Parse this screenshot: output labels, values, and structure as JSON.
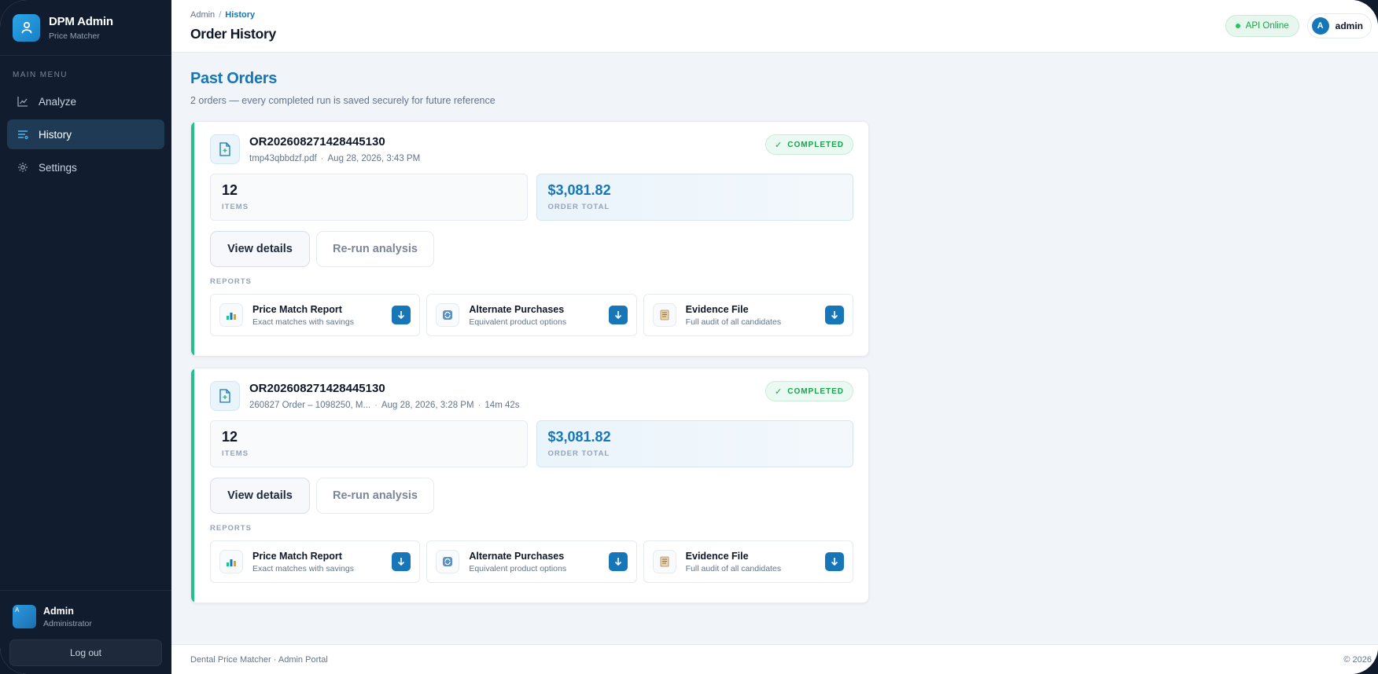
{
  "brand": {
    "title": "DPM Admin",
    "subtitle": "Price Matcher"
  },
  "sidebar": {
    "menu_label": "MAIN MENU",
    "items": [
      {
        "label": "Analyze",
        "icon": "chart-line-icon"
      },
      {
        "label": "History",
        "icon": "list-icon",
        "active": true
      },
      {
        "label": "Settings",
        "icon": "gear-icon"
      }
    ],
    "user": {
      "avatar_letter": "A",
      "name": "Admin",
      "role": "Administrator"
    },
    "logout_label": "Log out"
  },
  "header": {
    "breadcrumb": {
      "root": "Admin",
      "separator": "/",
      "current": "History"
    },
    "title": "Order History",
    "api_status": "API Online",
    "user_initial": "A",
    "user_name": "admin"
  },
  "page": {
    "title": "Past Orders",
    "subtitle": "2 orders — every completed run is saved securely for future reference"
  },
  "orders": [
    {
      "id": "OR202608271428445130",
      "file": "tmp43qbbdzf.pdf",
      "date": "Aug 28, 2026, 3:43 PM",
      "duration": "",
      "status": "COMPLETED",
      "items_value": "12",
      "items_label": "ITEMS",
      "total_value": "$3,081.82",
      "total_label": "ORDER TOTAL",
      "view_label": "View details",
      "rerun_label": "Re-run analysis",
      "reports_label": "REPORTS",
      "reports": [
        {
          "name": "Price Match Report",
          "desc": "Exact matches with savings"
        },
        {
          "name": "Alternate Purchases",
          "desc": "Equivalent product options"
        },
        {
          "name": "Evidence File",
          "desc": "Full audit of all candidates"
        }
      ]
    },
    {
      "id": "OR202608271428445130",
      "file": "260827 Order – 1098250, M...",
      "date": "Aug 28, 2026, 3:28 PM",
      "duration": "14m 42s",
      "status": "COMPLETED",
      "items_value": "12",
      "items_label": "ITEMS",
      "total_value": "$3,081.82",
      "total_label": "ORDER TOTAL",
      "view_label": "View details",
      "rerun_label": "Re-run analysis",
      "reports_label": "REPORTS",
      "reports": [
        {
          "name": "Price Match Report",
          "desc": "Exact matches with savings"
        },
        {
          "name": "Alternate Purchases",
          "desc": "Equivalent product options"
        },
        {
          "name": "Evidence File",
          "desc": "Full audit of all candidates"
        }
      ]
    }
  ],
  "footer": {
    "left": "Dental Price Matcher · Admin Portal",
    "right": "© 2026"
  },
  "colors": {
    "accent": "#1676b8",
    "success": "#22c08a",
    "sidebar": "#111c2e"
  }
}
